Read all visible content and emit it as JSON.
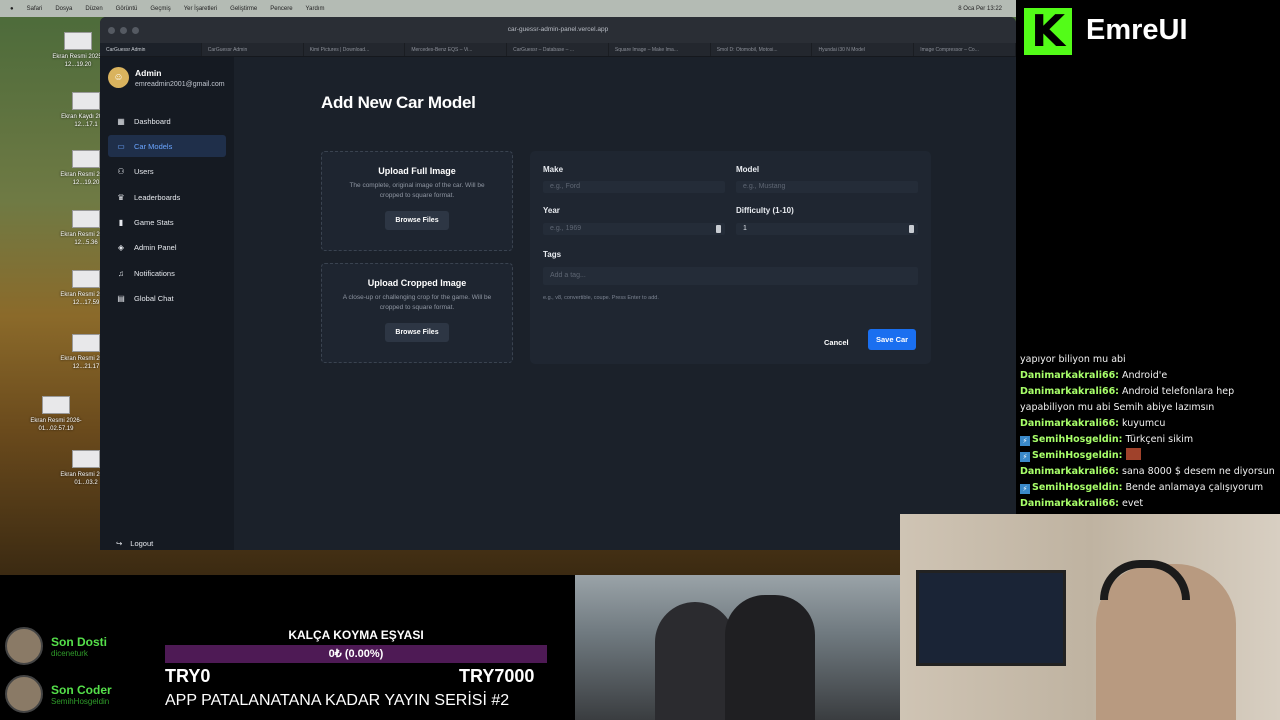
{
  "menubar": {
    "items": [
      "Safari",
      "Dosya",
      "Düzen",
      "Görüntü",
      "Geçmiş",
      "Yer İşaretleri",
      "Geliştirme",
      "Pencere",
      "Yardım"
    ],
    "clock": "8 Oca Per 13:22"
  },
  "desktop": {
    "files": [
      {
        "label": "Ekran Resmi 2025-12...19.20"
      },
      {
        "label": "Ekran Kaydı 2025-12...17.1"
      },
      {
        "label": "Ekran Resmi 2025-12...19.20"
      },
      {
        "label": "Ekran Resmi 2025-12...5.36"
      },
      {
        "label": "Ekran Resmi 2025-12...17.59"
      },
      {
        "label": "Ekran Resmi 2025-12...21.17"
      },
      {
        "label": "Ekran Resmi 2026-01...02.57.19"
      },
      {
        "label": "Ekran Resmi 2026-01...03.2"
      }
    ]
  },
  "browser": {
    "url": "car-guessr-admin-panel.vercel.app",
    "tabs": [
      "CarGuessr Admin",
      "CarGuessr Admin",
      "Kimi Pictures | Download...",
      "Mercedes-Benz EQS – Vi...",
      "CarGuessr – Database – ...",
      "Square Image – Make Ima...",
      "Smol D: Otomobil, Motosi...",
      "Hyundai i30 N Model",
      "Image Compressor – Co..."
    ]
  },
  "sidebar": {
    "user_name": "Admin",
    "user_email": "emreadmin2001@gmail.com",
    "items": [
      {
        "label": "Dashboard",
        "icon": "grid-icon"
      },
      {
        "label": "Car Models",
        "icon": "car-icon"
      },
      {
        "label": "Users",
        "icon": "users-icon"
      },
      {
        "label": "Leaderboards",
        "icon": "trophy-icon"
      },
      {
        "label": "Game Stats",
        "icon": "bar-chart-icon"
      },
      {
        "label": "Admin Panel",
        "icon": "shield-icon"
      },
      {
        "label": "Notifications",
        "icon": "bell-icon"
      },
      {
        "label": "Global Chat",
        "icon": "chat-icon"
      }
    ],
    "active_item": "Car Models",
    "logout_label": "Logout"
  },
  "page": {
    "title": "Add New Car Model",
    "upload_full": {
      "title": "Upload Full Image",
      "description": "The complete, original image of the car. Will be cropped to square format.",
      "button": "Browse Files"
    },
    "upload_cropped": {
      "title": "Upload Cropped Image",
      "description": "A close-up or challenging crop for the game. Will be cropped to square format.",
      "button": "Browse Files"
    },
    "form": {
      "make_label": "Make",
      "make_placeholder": "e.g., Ford",
      "model_label": "Model",
      "model_placeholder": "e.g., Mustang",
      "year_label": "Year",
      "year_placeholder": "e.g., 1969",
      "difficulty_label": "Difficulty (1-10)",
      "difficulty_value": "1",
      "tags_label": "Tags",
      "tags_placeholder": "Add a tag...",
      "tags_hint": "e.g., v8, convertible, coupe. Press Enter to add.",
      "cancel_label": "Cancel",
      "save_label": "Save Car"
    }
  },
  "stream": {
    "logo_text": "EmreUI",
    "logo_mark": "K",
    "chat": [
      {
        "user": "",
        "text": "yapıyor biliyon mu abi",
        "badge": false
      },
      {
        "user": "Danimarkakrali66:",
        "text": " Android'e",
        "badge": false
      },
      {
        "user": "Danimarkakrali66:",
        "text": " Android telefonlara hep yapabiliyon mu abi Semih abiye lazımsın",
        "badge": false
      },
      {
        "user": "Danimarkakrali66:",
        "text": " kuyumcu",
        "badge": false
      },
      {
        "user": "SemihHosgeldin:",
        "text": " Türkçeni sikim",
        "badge": true
      },
      {
        "user": "SemihHosgeldin:",
        "text": " ",
        "badge": true,
        "emote": true
      },
      {
        "user": "Danimarkakrali66:",
        "text": " sana 8000 $ desem ne diyorsun",
        "badge": false
      },
      {
        "user": "SemihHosgeldin:",
        "text": " Bende anlamaya çalışıyorum",
        "badge": true
      },
      {
        "user": "Danimarkakrali66:",
        "text": " evet",
        "badge": false
      }
    ],
    "last_donor_title": "Son Dosti",
    "last_donor_name": "diceneturk",
    "last_coder_title": "Son Coder",
    "last_coder_name": "SemihHosgeldin",
    "goal_title": "KALÇA KOYMA EŞYASI",
    "goal_progress_text": "0₺ (0.00%)",
    "goal_progress": 0,
    "goal_min": "TRY0",
    "goal_max": "TRY7000",
    "series_title": "APP PATALANATANA KADAR YAYIN SERİSİ #2"
  }
}
